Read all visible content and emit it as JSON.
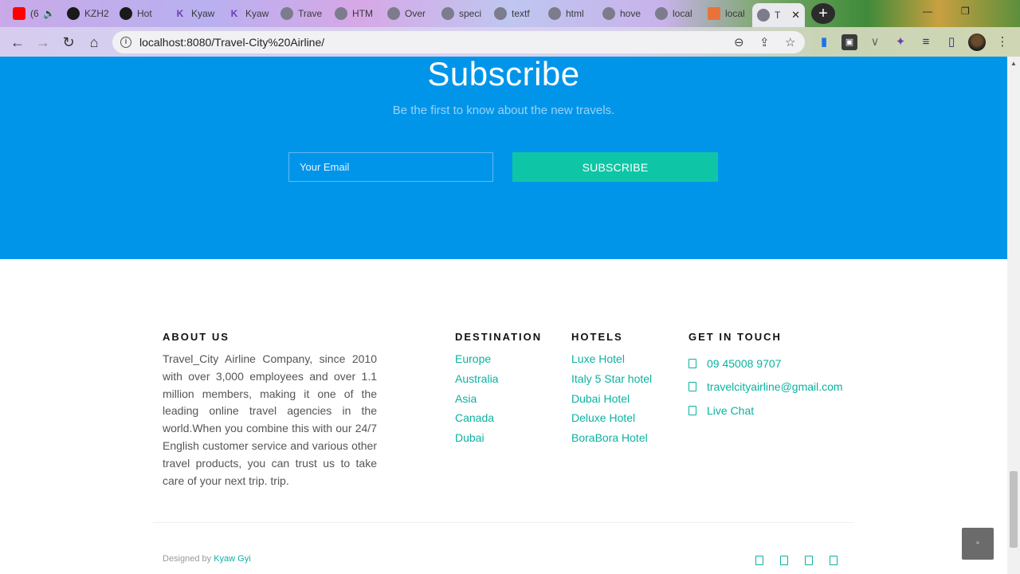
{
  "browser": {
    "tabs": [
      {
        "title": "(6",
        "favicon": "youtube-icon",
        "color": "#ff0000"
      },
      {
        "title": "KZH2",
        "favicon": "github-icon",
        "color": "#1a1a1a"
      },
      {
        "title": "Hot",
        "favicon": "app-icon",
        "color": "#1a1a1a"
      },
      {
        "title": "Kyaw",
        "favicon": "k-icon",
        "color": "#6a3fb0"
      },
      {
        "title": "Kyaw",
        "favicon": "k-icon",
        "color": "#6a3fb0"
      },
      {
        "title": "Trave",
        "favicon": "globe-icon",
        "color": "#7c7c8c"
      },
      {
        "title": "HTM",
        "favicon": "globe-icon",
        "color": "#7c7c8c"
      },
      {
        "title": "Over",
        "favicon": "globe-icon",
        "color": "#7c7c8c"
      },
      {
        "title": "speci",
        "favicon": "globe-icon",
        "color": "#7c7c8c"
      },
      {
        "title": "textf",
        "favicon": "globe-icon",
        "color": "#7c7c8c"
      },
      {
        "title": "html",
        "favicon": "globe-icon",
        "color": "#7c7c8c"
      },
      {
        "title": "hove",
        "favicon": "globe-icon",
        "color": "#7c7c8c"
      },
      {
        "title": "local",
        "favicon": "globe-icon",
        "color": "#7c7c8c"
      },
      {
        "title": "local",
        "favicon": "xampp-icon",
        "color": "#e8723a"
      },
      {
        "title": "T",
        "favicon": "globe-icon",
        "color": "#7c7c8c",
        "active": true
      }
    ],
    "new_tab_glyph": "+",
    "close_glyph": "✕",
    "url": "localhost:8080/Travel-City%20Airline/",
    "info_glyph": "i"
  },
  "subscribe": {
    "title": "Subscribe",
    "subtitle": "Be the first to know about the new travels.",
    "email_placeholder": "Your Email",
    "button_label": "SUBSCRIBE",
    "background": "#0195ea",
    "button_color": "#0ec6a5"
  },
  "footer": {
    "about": {
      "title": "ABOUT US",
      "text": "Travel_City Airline Company, since 2010 with over 3,000 employees and over 1.1 million members, making it one of the leading online travel agencies in the world.When you combine this with our 24/7 English customer service and various other travel products, you can trust us to take care of your next trip. trip."
    },
    "destination": {
      "title": "DESTINATION",
      "links": [
        "Europe",
        "Australia",
        "Asia",
        "Canada",
        "Dubai"
      ]
    },
    "hotels": {
      "title": "HOTELS",
      "links": [
        "Luxe Hotel",
        "Italy 5 Star hotel",
        "Dubai Hotel",
        "Deluxe Hotel",
        "BoraBora Hotel"
      ]
    },
    "contact": {
      "title": "GET IN TOUCH",
      "items": [
        {
          "icon": "phone-icon",
          "text": "09 45008 9707"
        },
        {
          "icon": "mail-icon",
          "text": "travelcityairline@gmail.com"
        },
        {
          "icon": "chat-icon",
          "text": "Live Chat"
        }
      ]
    },
    "credit_prefix": "Designed by",
    "credit_author": "Kyaw Gyi",
    "social_icons": [
      "facebook-icon",
      "twitter-icon",
      "instagram-icon",
      "linkedin-icon"
    ],
    "link_color": "#0ab2a0"
  },
  "back_to_top_glyph": "▫"
}
